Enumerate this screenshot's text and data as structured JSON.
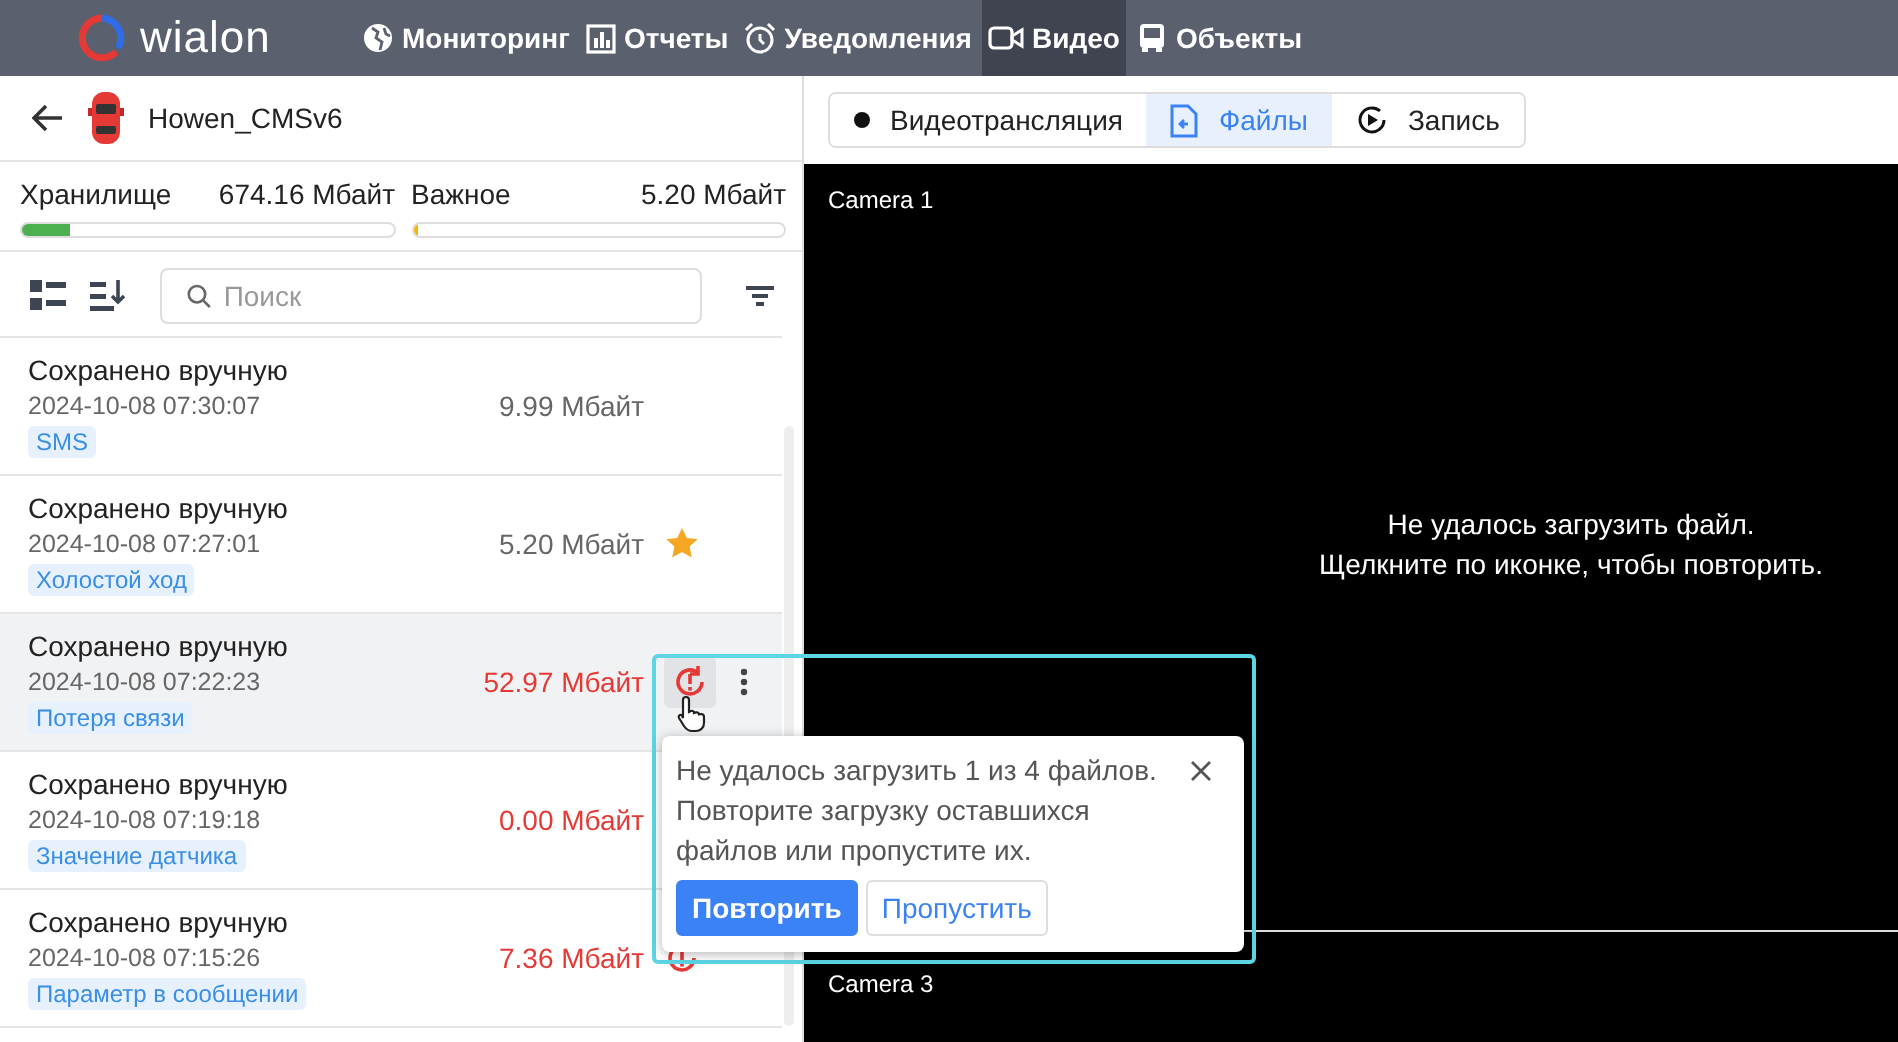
{
  "nav": {
    "logo": "wialon",
    "items": [
      {
        "label": "Мониторинг",
        "selected": false
      },
      {
        "label": "Отчеты",
        "selected": false
      },
      {
        "label": "Уведомления",
        "selected": false
      },
      {
        "label": "Видео",
        "selected": true
      },
      {
        "label": "Объекты",
        "selected": false
      }
    ]
  },
  "unit": {
    "name": "Howen_CMSv6"
  },
  "storage": [
    {
      "label": "Хранилище",
      "value": "674.16 Мбайт",
      "level": 0.13,
      "color": "#4caf50"
    },
    {
      "label": "Важное",
      "value": "5.20 Мбайт",
      "level": 0.01,
      "color": "#f5b800"
    }
  ],
  "search": {
    "placeholder": "Поиск"
  },
  "files": [
    {
      "title": "Сохранено вручную",
      "date": "2024-10-08 07:30:07",
      "size": "9.99 Мбайт",
      "tag": "SMS",
      "failed": false,
      "selected": false,
      "kind": "plain"
    },
    {
      "title": "Сохранено вручную",
      "date": "2024-10-08 07:27:01",
      "size": "5.20 Мбайт",
      "tag": "Холостой ход",
      "failed": false,
      "selected": false,
      "kind": "starred"
    },
    {
      "title": "Сохранено вручную",
      "date": "2024-10-08 07:22:23",
      "size": "52.97 Мбайт",
      "tag": "Потеря связи",
      "failed": true,
      "selected": true,
      "kind": "retry",
      "menu": true
    },
    {
      "title": "Сохранено вручную",
      "date": "2024-10-08 07:19:18",
      "size": "0.00 Мбайт",
      "tag": "Значение датчика",
      "failed": true,
      "selected": false,
      "kind": "plain"
    },
    {
      "title": "Сохранено вручную",
      "date": "2024-10-08 07:15:26",
      "size": "7.36 Мбайт",
      "tag": "Параметр в сообщении",
      "failed": true,
      "selected": false,
      "kind": "retry"
    }
  ],
  "modes": [
    {
      "label": "Видеотрансляция",
      "selected": false
    },
    {
      "label": "Файлы",
      "selected": true
    },
    {
      "label": "Запись",
      "selected": false
    }
  ],
  "video": {
    "cameras": [
      "Camera 1",
      "Camera 3"
    ],
    "message": [
      "Не удалось загрузить файл.",
      "Щелкните по иконке, чтобы повторить."
    ]
  },
  "popup": {
    "text": "Не удалось загрузить 1 из 4 файлов. Повторите загрузку оставшихся файлов или пропустите их.",
    "primary": "Повторить",
    "secondary": "Пропустить"
  }
}
